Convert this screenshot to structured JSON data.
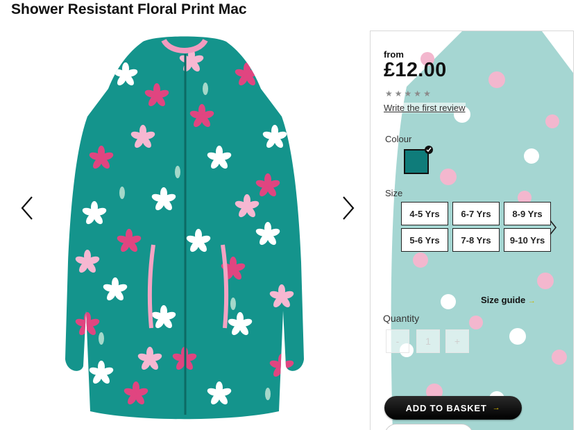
{
  "product": {
    "title": "Shower Resistant Floral Print Mac",
    "price_prefix": "from",
    "price": "£12.00",
    "rating_stars": 5,
    "review_link": "Write the first review"
  },
  "gallery": {
    "prev_icon": "chevron-left-icon",
    "next_icon": "chevron-right-icon"
  },
  "colour": {
    "label": "Colour",
    "selected_swatch": "#0f7c7a"
  },
  "size": {
    "label": "Size",
    "options": [
      "4-5 Yrs",
      "6-7 Yrs",
      "8-9 Yrs",
      "5-6 Yrs",
      "7-8 Yrs",
      "9-10 Yrs"
    ],
    "guide_label": "Size guide",
    "guide_arrow": "→"
  },
  "quantity": {
    "label": "Quantity",
    "minus": "-",
    "value": "1",
    "plus": "+"
  },
  "basket": {
    "label": "ADD TO BASKET",
    "arrow": "→"
  },
  "colors": {
    "jacket": "#14948c",
    "accent_pink": "#e04580",
    "button": "#000000",
    "arrow_yellow": "#e6c300"
  }
}
